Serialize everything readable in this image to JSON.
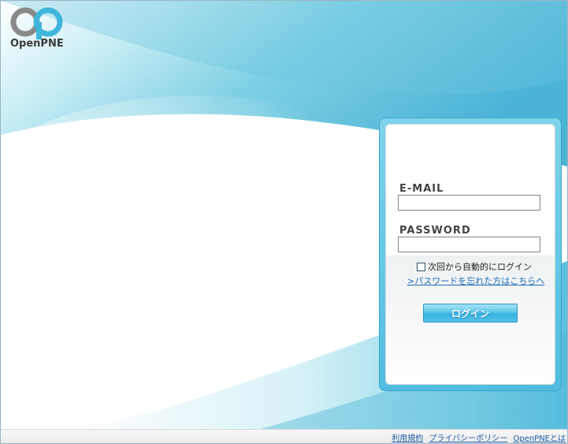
{
  "logo": {
    "text": "OpenPNE"
  },
  "login": {
    "email_label": "E-MAIL",
    "email_value": "",
    "password_label": "PASSWORD",
    "password_value": "",
    "remember_label": "次回から自動的にログイン",
    "remember_checked": false,
    "forgot_link": ">パスワードを忘れた方はこちらへ",
    "submit_label": "ログイン"
  },
  "footer": {
    "links": [
      "利用規約",
      "プライバシーポリシー",
      "OpenPNEとは"
    ]
  },
  "colors": {
    "accent": "#4fbde0",
    "link": "#1a6cb8",
    "logo_gray": "#8a8a8a",
    "logo_blue": "#3fb6dc"
  }
}
